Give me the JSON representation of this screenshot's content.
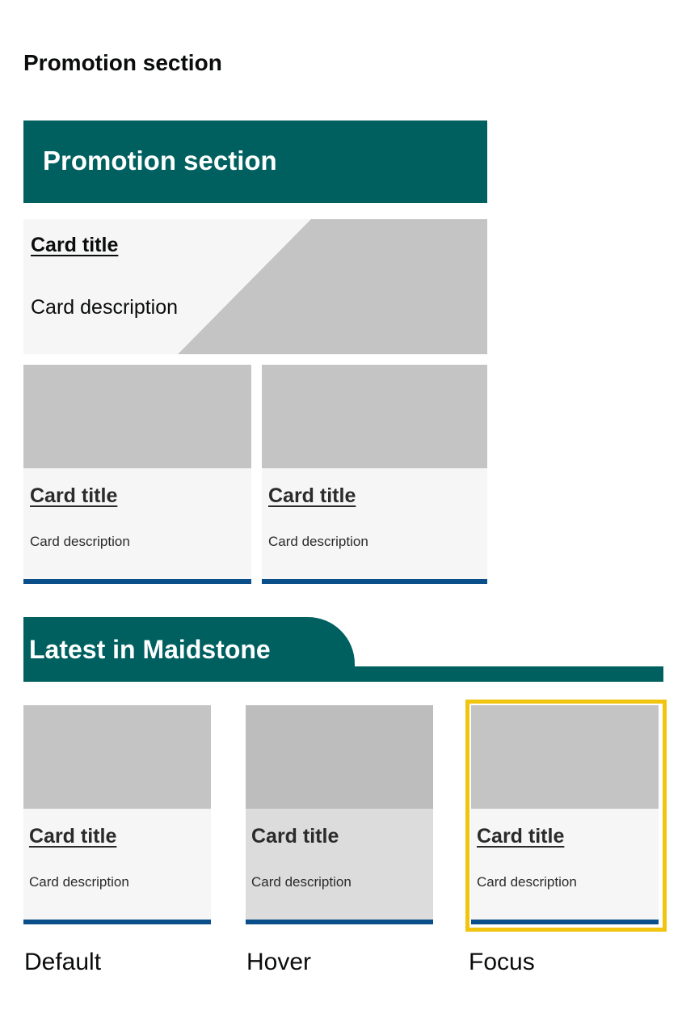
{
  "page_heading": "Promotion section",
  "promotion_section": {
    "title": "Promotion section",
    "feature_card": {
      "title": "Card title",
      "description": "Card description"
    },
    "cards": [
      {
        "title": "Card title",
        "description": "Card description"
      },
      {
        "title": "Card title",
        "description": "Card description"
      }
    ]
  },
  "latest_section": {
    "title": "Latest in Maidstone",
    "cards": [
      {
        "title": "Card title",
        "description": "Card description",
        "state": "Default"
      },
      {
        "title": "Card title",
        "description": "Card description",
        "state": "Hover"
      },
      {
        "title": "Card title",
        "description": "Card description",
        "state": "Focus"
      }
    ]
  },
  "colors": {
    "brand_teal": "#006060",
    "card_background": "#f5f6f5",
    "card_bar_blue": "#0b4f8a",
    "image_placeholder": "#c4c4c4",
    "focus_yellow": "#f1c40f",
    "hover_background": "#dcdcdc"
  }
}
